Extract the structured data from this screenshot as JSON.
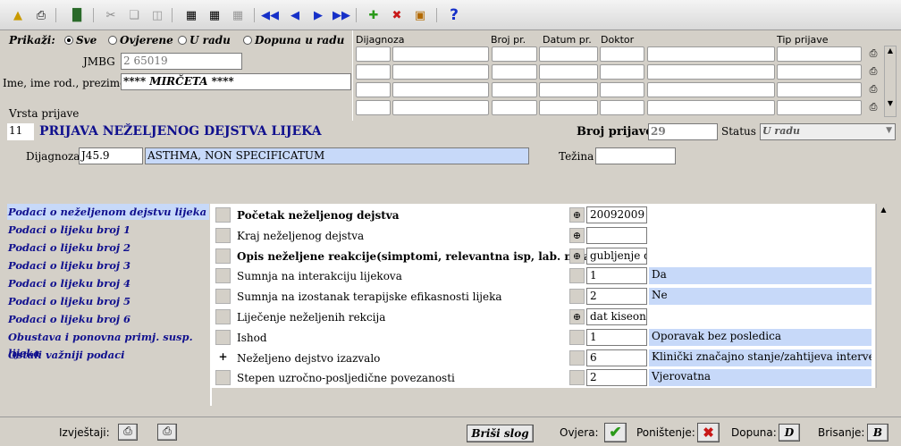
{
  "toolbar": {
    "icons": [
      "open-folder-icon",
      "print-icon",
      "exit-door-icon",
      "cut-icon",
      "copy-icon",
      "paste-icon",
      "calc-icon",
      "calc-question-icon",
      "calc-disabled-icon",
      "first-record-icon",
      "prev-record-icon",
      "next-record-icon",
      "last-record-icon",
      "add-record-icon",
      "delete-record-icon",
      "lock-icon",
      "help-icon"
    ],
    "help_glyph": "?"
  },
  "prikazi": {
    "label": "Prikaži:",
    "options": [
      "Sve",
      "Ovjerene",
      "U radu",
      "Dopuna u radu"
    ],
    "selected": 0
  },
  "jmbg": {
    "label": "JMBG",
    "value": "2            65019"
  },
  "ime": {
    "label": "Ime, ime rod., prezime",
    "value": "**** MIRČETA ****"
  },
  "grid": {
    "headers": [
      "Dijagnoza",
      "Broj pr.",
      "Datum pr.",
      "Doktor",
      "Tip prijave"
    ]
  },
  "vrsta": {
    "label": "Vrsta prijave",
    "code": "11",
    "name": "PRIJAVA NEŽELJENOG DEJSTVA LIJEKA"
  },
  "broj_prijave": {
    "label": "Broj prijave",
    "value": "29"
  },
  "status": {
    "label": "Status",
    "value": "U radu"
  },
  "dijagnoza": {
    "label": "Dijagnoza",
    "code": "J45.9",
    "name": "ASTHMA, NON SPECIFICATUM"
  },
  "tezina": {
    "label": "Težina",
    "value": ""
  },
  "nav": [
    "Podaci o neželjenom dejstvu lijeka",
    "Podaci o lijeku broj 1",
    "Podaci o lijeku broj 2",
    "Podaci o lijeku broj 3",
    "Podaci o lijeku broj 4",
    "Podaci o lijeku broj 5",
    "Podaci o lijeku broj 6",
    "Obustava i ponovna primj. susp. lijeka",
    "Ostali važniji podaci"
  ],
  "rows": [
    {
      "label": "Početak neželjenog dejstva",
      "bold": true,
      "zoom": true,
      "value": "20092009",
      "desc": "",
      "check": ""
    },
    {
      "label": "Kraj neželjenog dejstva",
      "bold": false,
      "zoom": true,
      "value": "",
      "desc": "",
      "check": ""
    },
    {
      "label": "Opis neželjene reakcije(simptomi, relevantna isp, lab. nalazi)",
      "bold": true,
      "zoom": true,
      "value": "gubljenje da",
      "desc": "",
      "check": ""
    },
    {
      "label": "Sumnja na interakciju lijekova",
      "bold": false,
      "zoom": false,
      "value": "1",
      "desc": "Da",
      "check": ""
    },
    {
      "label": "Sumnja na izostanak terapijske efikasnosti lijeka",
      "bold": false,
      "zoom": false,
      "value": "2",
      "desc": "Ne",
      "check": ""
    },
    {
      "label": "Liječenje neželjenih rekcija",
      "bold": false,
      "zoom": true,
      "value": "dat kiseonik",
      "desc": "",
      "check": ""
    },
    {
      "label": "Ishod",
      "bold": false,
      "zoom": false,
      "value": "1",
      "desc": "Oporavak bez posledica",
      "check": ""
    },
    {
      "label": "Neželjeno dejstvo izazvalo",
      "bold": false,
      "zoom": false,
      "value": "6",
      "desc": "Klinički značajno stanje/zahtijeva intervenciju",
      "check": "+"
    },
    {
      "label": "Stepen uzročno-posljedične povezanosti",
      "bold": false,
      "zoom": false,
      "value": "2",
      "desc": "Vjerovatna",
      "check": ""
    }
  ],
  "bottom": {
    "izvjestaji": "Izvještaji:",
    "brisi_slog": "Briši slog",
    "ovjera": "Ovjera:",
    "ponistenje": "Poništenje:",
    "dopuna": "Dopuna:",
    "dopuna_key": "D",
    "brisanje": "Brisanje:",
    "brisanje_key": "B"
  },
  "colors": {
    "accent_text": "#10108e",
    "selected_bg": "#c7d9f9",
    "check_green": "#2a9a1a",
    "cross_red": "#c81818"
  }
}
